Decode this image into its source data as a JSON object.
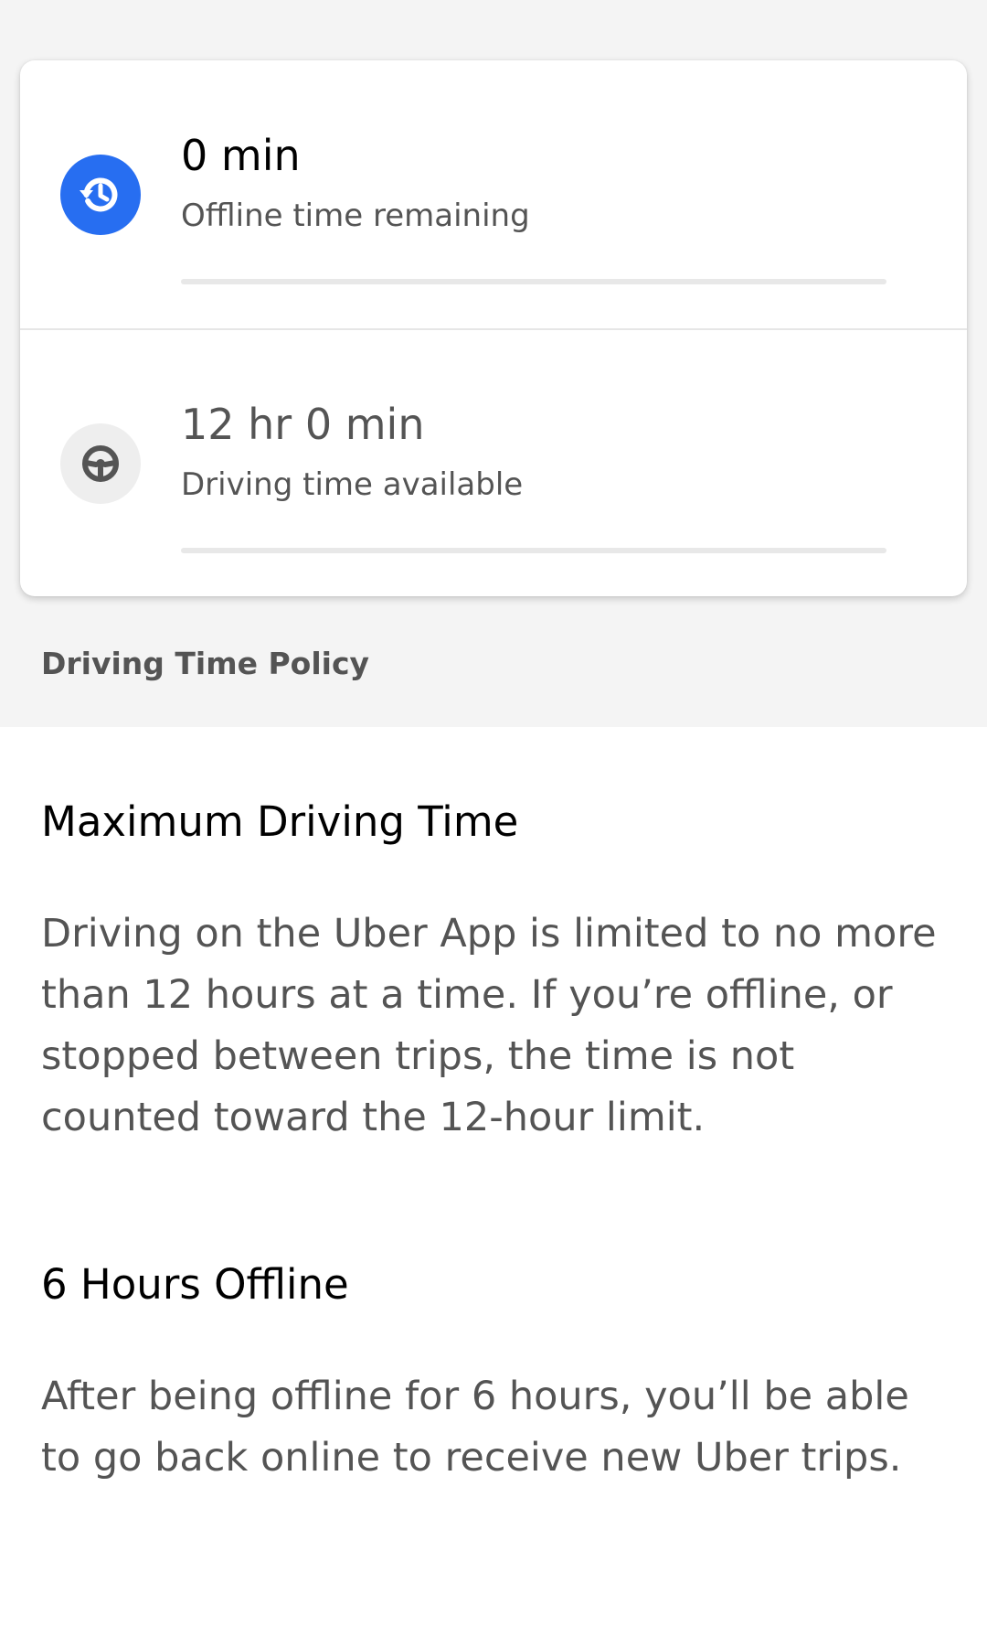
{
  "status_card": {
    "offline": {
      "value": "0 min",
      "caption": "Offline time remaining",
      "icon": "history-icon",
      "icon_color": "#276ef1",
      "progress": 0
    },
    "driving": {
      "value": "12 hr 0 min",
      "caption": "Driving time available",
      "icon": "steering-wheel-icon",
      "progress": 0
    }
  },
  "policy": {
    "section_title": "Driving Time Policy",
    "sections": [
      {
        "heading": "Maximum Driving Time",
        "body": "Driving on the Uber App is limited to no more than 12 hours at a time. If you’re offline, or stopped between trips, the time is not counted toward the 12-hour limit."
      },
      {
        "heading": "6 Hours Offline",
        "body": "After being offline for 6 hours, you’ll be able to go back online to receive new Uber trips."
      }
    ]
  }
}
